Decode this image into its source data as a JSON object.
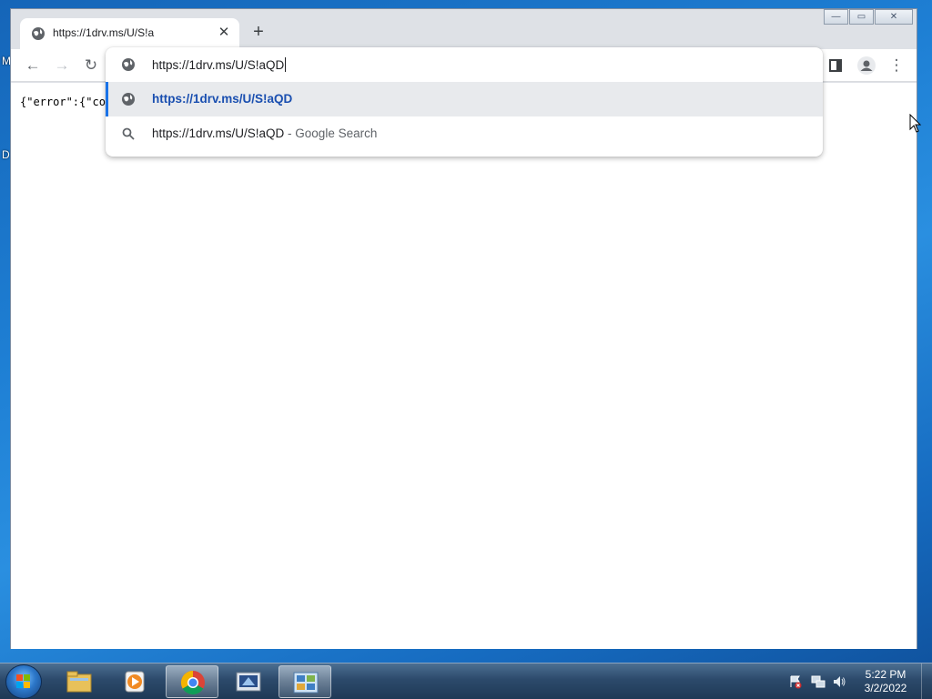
{
  "desktop": {
    "fragments": [
      "M",
      "D"
    ]
  },
  "window": {
    "tab": {
      "title": "https://1drv.ms/U/S!a",
      "close_glyph": "✕"
    },
    "new_tab_glyph": "+",
    "controls": {
      "minimize": "—",
      "maximize": "▭",
      "close": "✕"
    }
  },
  "toolbar": {
    "back": "←",
    "forward": "→",
    "reload": "↻",
    "menu": "⋮"
  },
  "omnibox": {
    "input_value": "https://1drv.ms/U/S!aQD",
    "suggestions": [
      {
        "text": "https://1drv.ms/U/S!aQD",
        "suffix": "",
        "icon": "globe-icon",
        "selected": true
      },
      {
        "text": "https://1drv.ms/U/S!aQD",
        "suffix": " - Google Search",
        "icon": "search-icon",
        "selected": false
      }
    ]
  },
  "page": {
    "json_text": "{\"error\":{\"co"
  },
  "taskbar": {
    "clock_time": "5:22 PM",
    "clock_date": "3/2/2022",
    "items": [
      "folder-icon",
      "media-player-icon",
      "chrome-icon",
      "network-app-icon",
      "control-panel-icon"
    ]
  },
  "colors": {
    "accent": "#1a73e8",
    "suggestion_url": "#1a4fb0",
    "selected_row": "#e8eaed"
  }
}
